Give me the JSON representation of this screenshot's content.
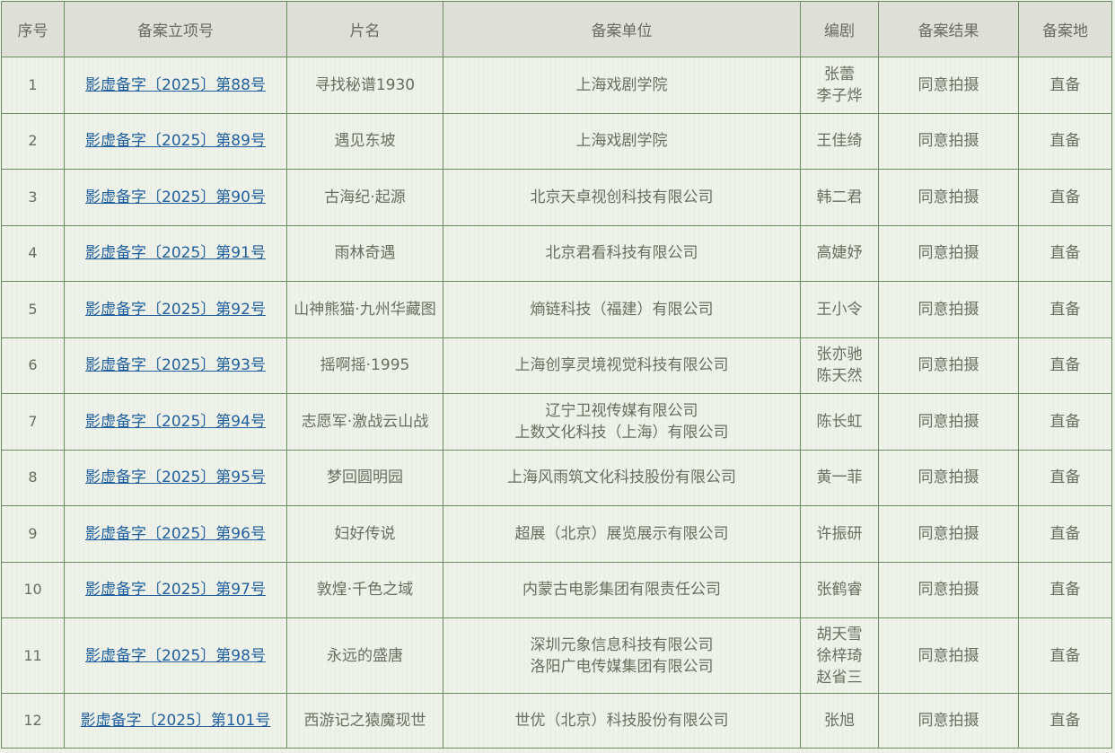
{
  "headers": [
    "序号",
    "备案立项号",
    "片名",
    "备案单位",
    "编剧",
    "备案结果",
    "备案地"
  ],
  "rows": [
    {
      "index": "1",
      "number": "影虚备字〔2025〕第88号",
      "title": "寻找秘谱1930",
      "units": [
        "上海戏剧学院"
      ],
      "writers": [
        "张蕾",
        "李子烨"
      ],
      "result": "同意拍摄",
      "place": "直备"
    },
    {
      "index": "2",
      "number": "影虚备字〔2025〕第89号",
      "title": "遇见东坡",
      "units": [
        "上海戏剧学院"
      ],
      "writers": [
        "王佳绮"
      ],
      "result": "同意拍摄",
      "place": "直备"
    },
    {
      "index": "3",
      "number": "影虚备字〔2025〕第90号",
      "title": "古海纪·起源",
      "units": [
        "北京天卓视创科技有限公司"
      ],
      "writers": [
        "韩二君"
      ],
      "result": "同意拍摄",
      "place": "直备"
    },
    {
      "index": "4",
      "number": "影虚备字〔2025〕第91号",
      "title": "雨林奇遇",
      "units": [
        "北京君看科技有限公司"
      ],
      "writers": [
        "高婕妤"
      ],
      "result": "同意拍摄",
      "place": "直备"
    },
    {
      "index": "5",
      "number": "影虚备字〔2025〕第92号",
      "title": "山神熊猫·九州华藏图",
      "units": [
        "熵链科技（福建）有限公司"
      ],
      "writers": [
        "王小令"
      ],
      "result": "同意拍摄",
      "place": "直备"
    },
    {
      "index": "6",
      "number": "影虚备字〔2025〕第93号",
      "title": "摇啊摇·1995",
      "units": [
        "上海创享灵境视觉科技有限公司"
      ],
      "writers": [
        "张亦驰",
        "陈天然"
      ],
      "result": "同意拍摄",
      "place": "直备"
    },
    {
      "index": "7",
      "number": "影虚备字〔2025〕第94号",
      "title": "志愿军·激战云山战",
      "units": [
        "辽宁卫视传媒有限公司",
        "上数文化科技（上海）有限公司"
      ],
      "writers": [
        "陈长虹"
      ],
      "result": "同意拍摄",
      "place": "直备"
    },
    {
      "index": "8",
      "number": "影虚备字〔2025〕第95号",
      "title": "梦回圆明园",
      "units": [
        "上海风雨筑文化科技股份有限公司"
      ],
      "writers": [
        "黄一菲"
      ],
      "result": "同意拍摄",
      "place": "直备"
    },
    {
      "index": "9",
      "number": "影虚备字〔2025〕第96号",
      "title": "妇好传说",
      "units": [
        "超展（北京）展览展示有限公司"
      ],
      "writers": [
        "许振研"
      ],
      "result": "同意拍摄",
      "place": "直备"
    },
    {
      "index": "10",
      "number": "影虚备字〔2025〕第97号",
      "title": "敦煌·千色之域",
      "units": [
        "内蒙古电影集团有限责任公司"
      ],
      "writers": [
        "张鹤睿"
      ],
      "result": "同意拍摄",
      "place": "直备"
    },
    {
      "index": "11",
      "number": "影虚备字〔2025〕第98号",
      "title": "永远的盛唐",
      "units": [
        "深圳元象信息科技有限公司",
        "洛阳广电传媒集团有限公司"
      ],
      "writers": [
        "胡天雪",
        "徐梓琦",
        "赵省三"
      ],
      "result": "同意拍摄",
      "place": "直备"
    },
    {
      "index": "12",
      "number": "影虚备字〔2025〕第101号",
      "title": "西游记之猿魔现世",
      "units": [
        "世优（北京）科技股份有限公司"
      ],
      "writers": [
        "张旭"
      ],
      "result": "同意拍摄",
      "place": "直备"
    }
  ]
}
